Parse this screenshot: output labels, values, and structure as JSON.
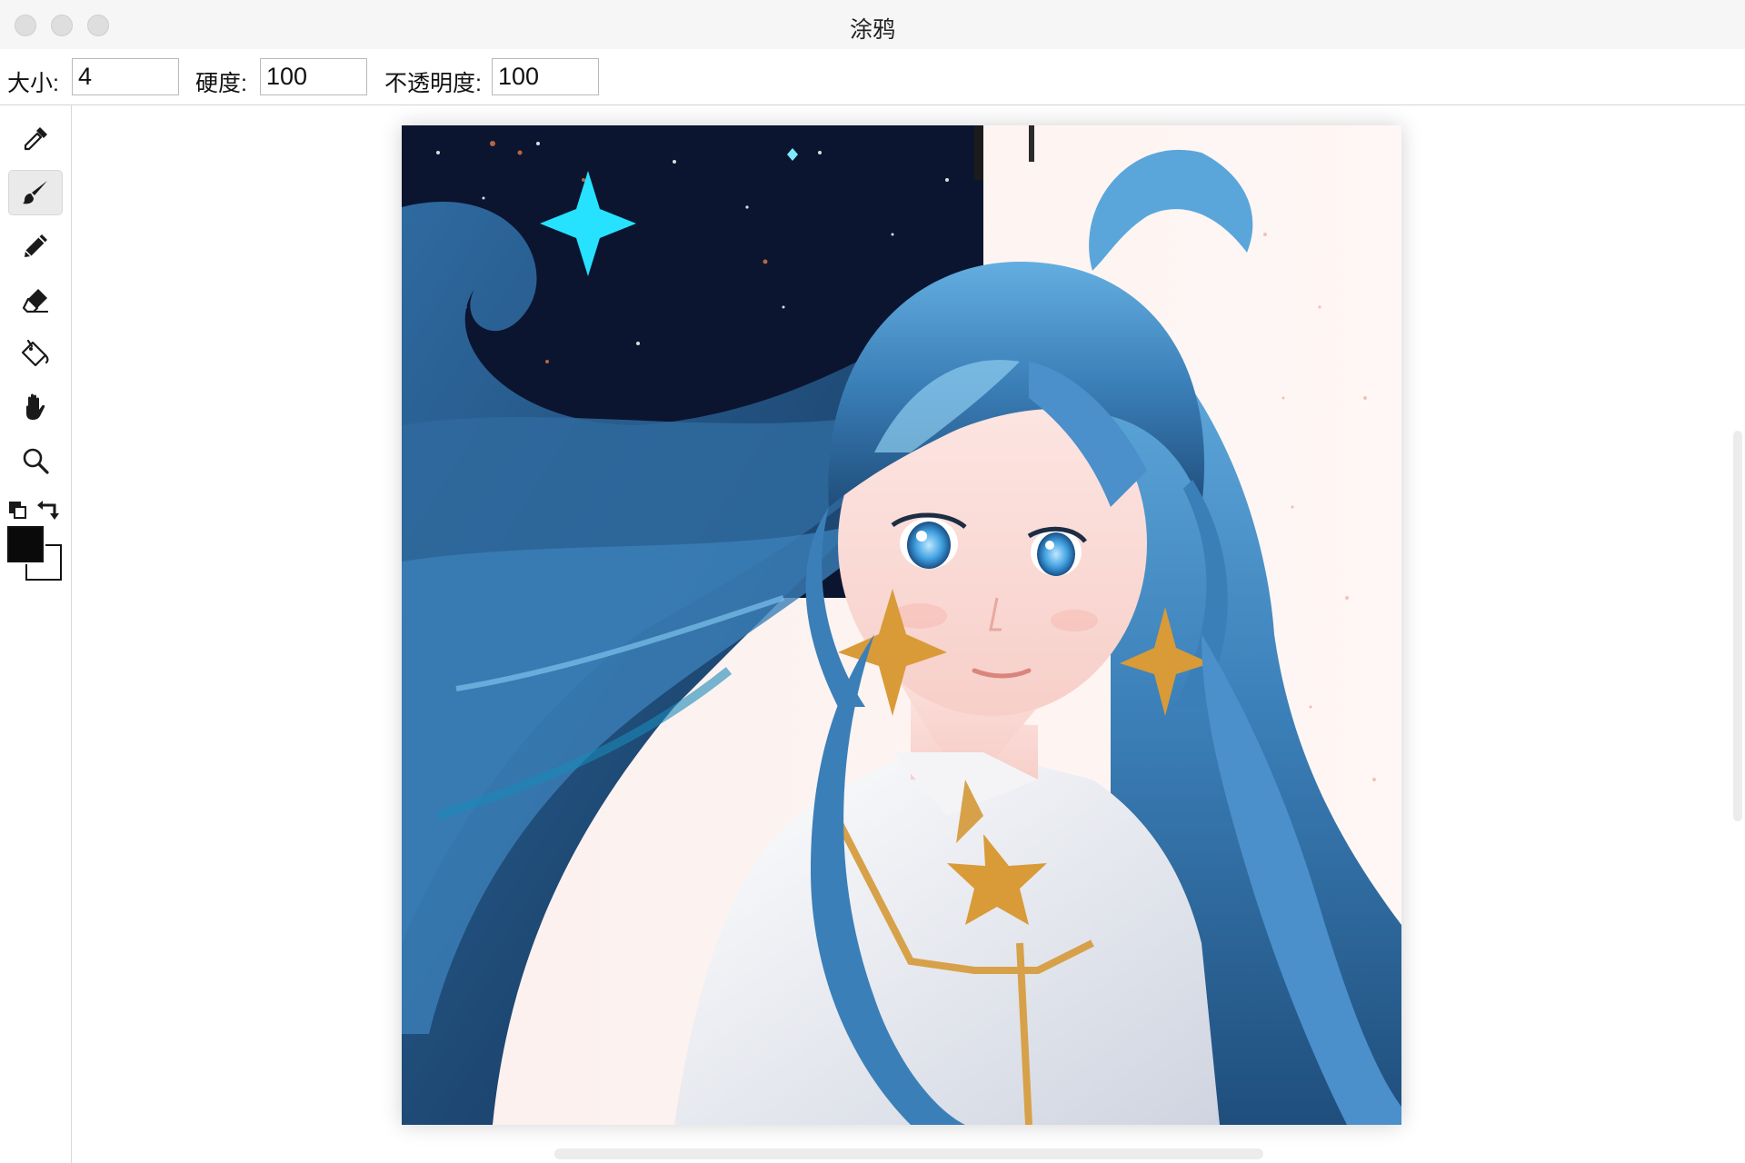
{
  "window": {
    "title": "涂鸦"
  },
  "options": {
    "size_label": "大小:",
    "size_value": "4",
    "hardness_label": "硬度:",
    "hardness_value": "100",
    "opacity_label": "不透明度:",
    "opacity_value": "100"
  },
  "tools": [
    {
      "name": "eyedropper",
      "icon": "eyedropper-icon",
      "active": false
    },
    {
      "name": "brush",
      "icon": "brush-icon",
      "active": true
    },
    {
      "name": "pencil",
      "icon": "pencil-icon",
      "active": false
    },
    {
      "name": "eraser",
      "icon": "eraser-icon",
      "active": false
    },
    {
      "name": "fill",
      "icon": "paint-bucket-icon",
      "active": false
    },
    {
      "name": "hand",
      "icon": "hand-icon",
      "active": false
    },
    {
      "name": "zoom",
      "icon": "magnifier-icon",
      "active": false
    }
  ],
  "colors": {
    "foreground": "#0a0a0a",
    "background": "#ffffff"
  },
  "canvas": {
    "content": "anime girl with long blue hair, blue eyes, gold star earrings and white outfit against a starry night sky"
  }
}
